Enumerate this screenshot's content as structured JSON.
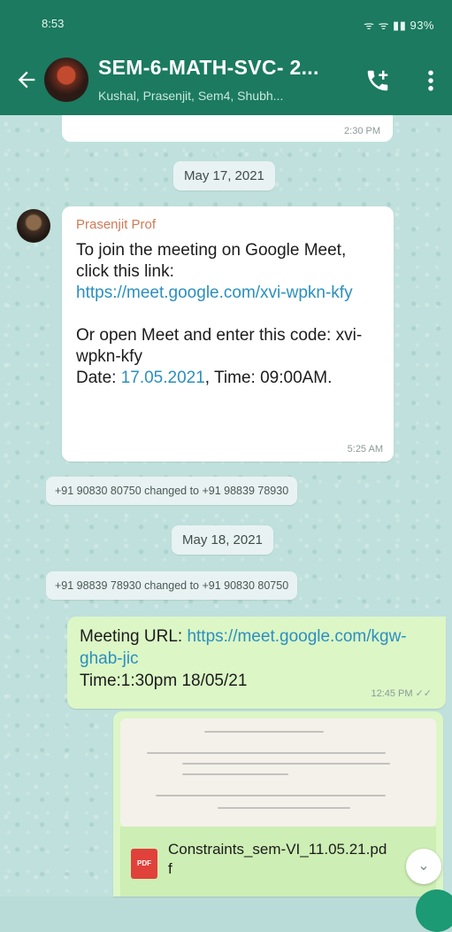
{
  "status_bar": {
    "time": "8:53",
    "indicators": "ᯤ ᯤ ▮▮ 93%"
  },
  "header": {
    "title": "SEM-6-MATH-SVC- 2...",
    "subtitle": "Kushal, Prasenjit, Sem4, Shubh...",
    "icons": [
      "back-arrow-icon",
      "add-call-icon",
      "more-vertical-icon"
    ]
  },
  "messages": {
    "previous_timestamp": "2:30 PM",
    "date_1": "May 17, 2021",
    "incoming": {
      "sender": "Prasenjit Prof",
      "line_1": "To join the meeting on Google Meet, click this link:",
      "link": "https://meet.google.com/xvi-wpkn-kfy",
      "line_2": "Or open Meet and enter this code: xvi-wpkn-kfy",
      "date_prefix": "Date: ",
      "date_value": "17.05.2021",
      "time_suffix": ", Time: 09:00AM.",
      "timestamp": "5:25 AM"
    },
    "system_1": "+91 90830 80750 changed to +91 98839 78930",
    "date_2": "May 18, 2021",
    "system_2": "+91 98839 78930 changed to +91 90830 80750",
    "outgoing": {
      "label": "Meeting URL: ",
      "link": "https://meet.google.com/kgw-ghab-jic",
      "time_line": "Time:1:30pm 18/05/21",
      "timestamp": "12:45 PM",
      "ticks": "✓✓"
    },
    "document": {
      "file_icon_label": "PDF",
      "file_name": "Constraints_sem-VI_11.05.21.pdf"
    },
    "scroll_down": "⌄"
  },
  "colors": {
    "header": "#1b7a5f",
    "incoming_bubble": "#ffffff",
    "outgoing_bubble": "#dcf6c6",
    "link": "#2b8fbf",
    "sender_name": "#d07a56"
  }
}
